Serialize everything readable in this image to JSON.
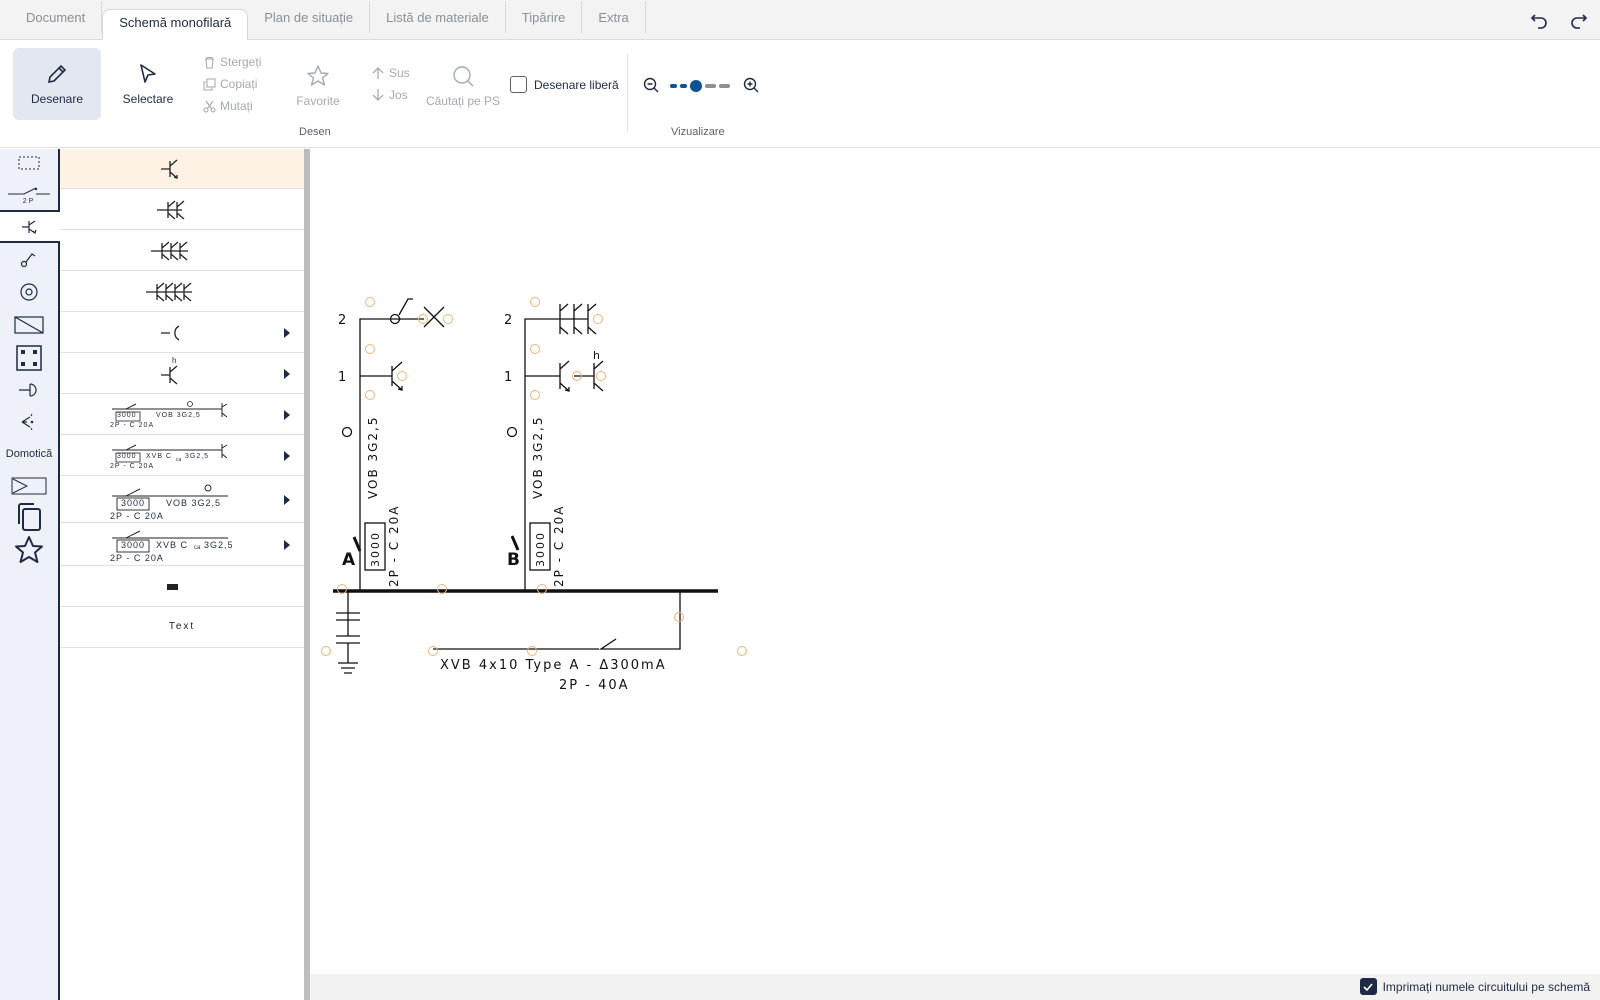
{
  "tabs": [
    "Document",
    "Schemă monofilară",
    "Plan de situație",
    "Listă de materiale",
    "Tipărire",
    "Extra"
  ],
  "ribbon": {
    "draw_label": "Desenare",
    "select_label": "Selectare",
    "delete_label": "Stergeți",
    "copy_label": "Copiați",
    "move_label": "Mutați",
    "favorites_label": "Favorite",
    "up_label": "Sus",
    "down_label": "Jos",
    "search_ps_label": "Căutați pe PS",
    "free_draw_label": "Desenare liberă",
    "group_draw": "Desen",
    "group_view": "Vizualizare"
  },
  "rail": {
    "domotica_label": "Domotică",
    "switch_caption": "2P"
  },
  "symbols": {
    "thumb1_codes": "3000",
    "thumb1_cable": "VOB 3G2,5",
    "thumb1_breaker": "2P - C 20A",
    "thumb2_codes": "3000",
    "thumb2_cable": "XVB C",
    "thumb2_cable_sub": "ca",
    "thumb2_cable_end": "3G2,5",
    "thumb2_breaker": "2P - C 20A",
    "thumb3_codes": "3000",
    "thumb3_cable": "VOB 3G2,5",
    "thumb3_breaker": "2P - C 20A",
    "thumb4_codes": "3000",
    "thumb4_cable": "XVB C",
    "thumb4_cable_sub": "ca",
    "thumb4_cable_end": "3G2,5",
    "thumb4_breaker": "2P - C 20A",
    "text_item": "Text",
    "h_label": "h"
  },
  "schematic": {
    "circuit_a": {
      "name": "A",
      "row1": "1",
      "row2": "2",
      "cable": "VOB 3G2,5",
      "code": "3000",
      "breaker": "2P - C 20A"
    },
    "circuit_b": {
      "name": "B",
      "row1": "1",
      "row2": "2",
      "cable": "VOB 3G2,5",
      "code": "3000",
      "breaker": "2P - C 20A",
      "h_label": "h"
    },
    "main_cable": "XVB 4x10 Type A - Δ300mA",
    "main_breaker": "2P - 40A"
  },
  "status": {
    "print_circuit_names_label": "Imprimați numele circuitului pe schemă",
    "print_circuit_names_checked": true
  },
  "colors": {
    "accent": "#1f2a44",
    "zoom_thumb": "#0b5394",
    "handle": "#f0b27a"
  }
}
